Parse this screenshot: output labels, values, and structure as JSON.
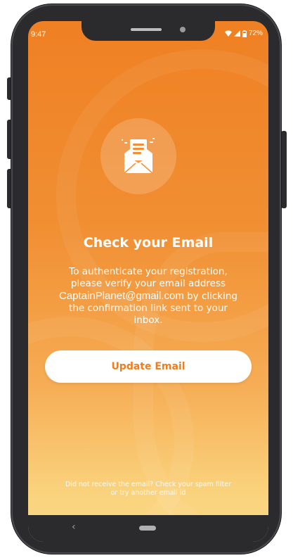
{
  "status_bar": {
    "time": "9:47",
    "battery": "72%"
  },
  "icons": {
    "email_icon": "open-envelope-icon",
    "wifi": "wifi-icon",
    "signal": "signal-icon",
    "battery": "battery-icon",
    "back": "back-chevron-icon",
    "home": "home-pill-icon"
  },
  "colors": {
    "accent": "#ef8023",
    "button_text": "#ee7d1f",
    "gradient_bottom": "#fbd986"
  },
  "content": {
    "title": "Check your Email",
    "line1": "To authenticate your registration,",
    "line2": "please verify your email address",
    "email": "CaptainPlanet@gmail.com",
    "line3_suffix": " by clicking",
    "line4": "the confirmation link sent to your",
    "line5": "inbox."
  },
  "actions": {
    "update_email_label": "Update Email"
  },
  "footer": {
    "line1": "Did not receive the email? Check your spam filter",
    "line2": "or try another email id"
  },
  "nav": {
    "back_glyph": "‹"
  }
}
